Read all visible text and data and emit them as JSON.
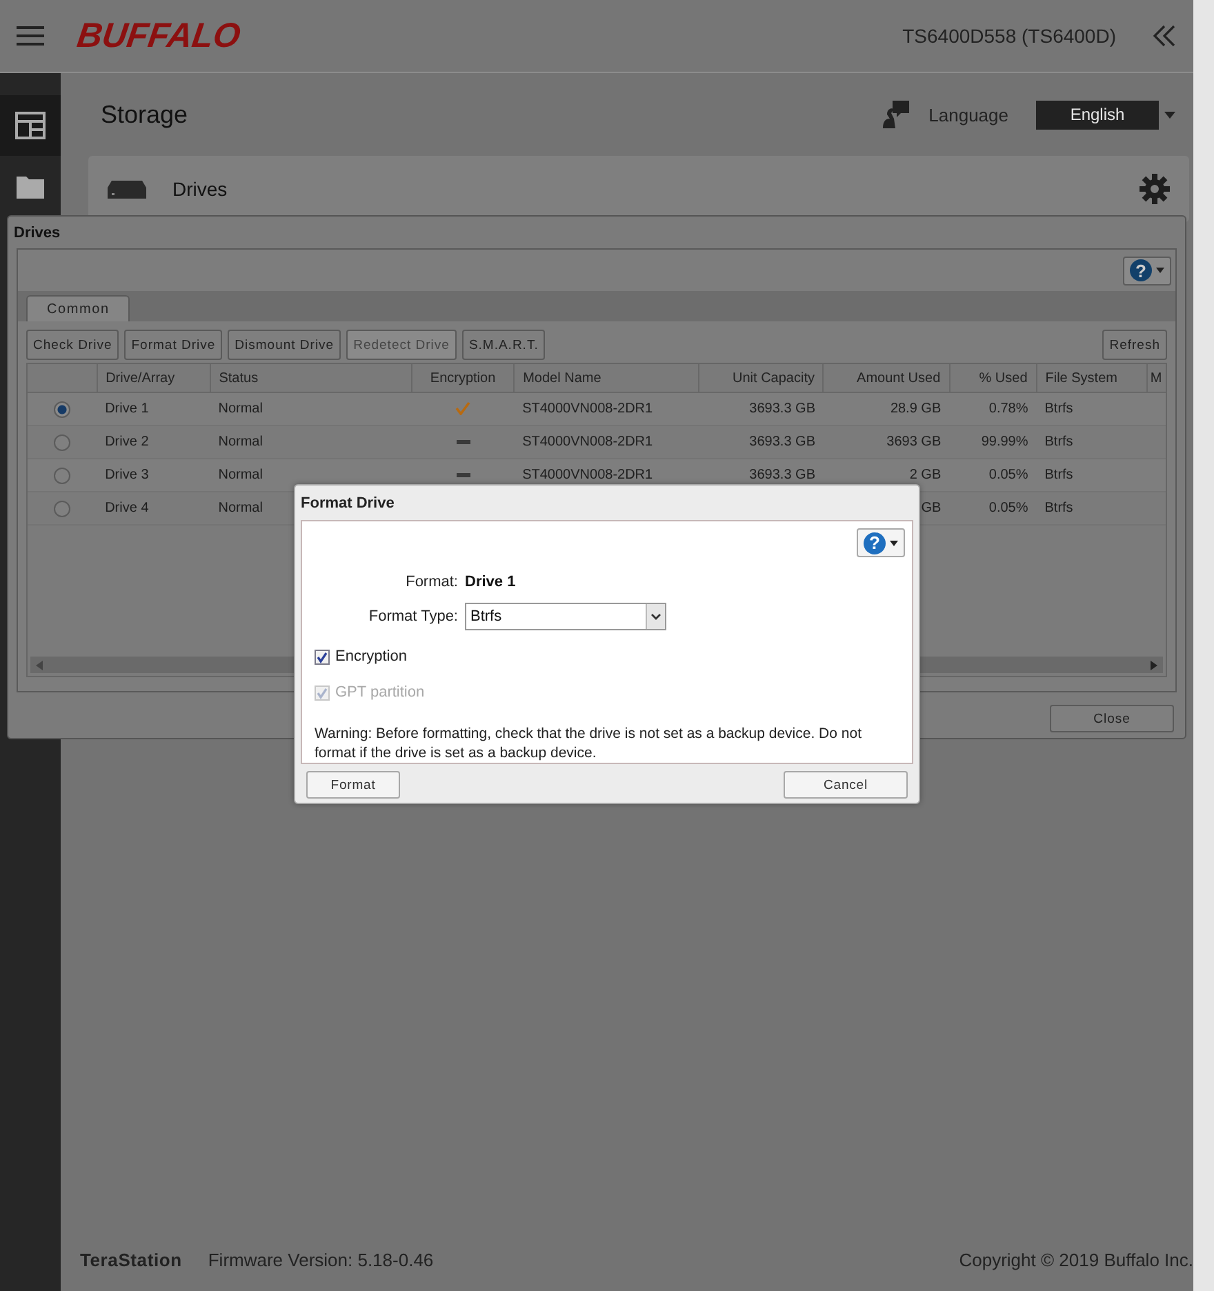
{
  "header": {
    "logo": "BUFFALO",
    "device": "TS6400D558 (TS6400D)"
  },
  "page": {
    "title": "Storage",
    "language_label": "Language",
    "language": "English",
    "card_title": "Drives"
  },
  "drives_window": {
    "title": "Drives",
    "help": "?",
    "tabs": [
      {
        "label": "Common",
        "selected": true
      }
    ],
    "buttons": [
      {
        "label": "Check Drive",
        "disabled": false
      },
      {
        "label": "Format Drive",
        "disabled": false
      },
      {
        "label": "Dismount Drive",
        "disabled": false
      },
      {
        "label": "Redetect Drive",
        "disabled": true
      },
      {
        "label": "S.M.A.R.T.",
        "disabled": false
      }
    ],
    "refresh": "Refresh",
    "columns": [
      "",
      "Drive/Array",
      "Status",
      "Encryption",
      "Model Name",
      "Unit Capacity",
      "Amount Used",
      "% Used",
      "File System",
      "M"
    ],
    "rows": [
      {
        "selected": true,
        "drive": "Drive 1",
        "status": "Normal",
        "encryption": {
          "kind": "check"
        },
        "model": "ST4000VN008-2DR1",
        "capacity": "3693.3 GB",
        "used": "28.9 GB",
        "percent": "0.78%",
        "file_system": "Btrfs"
      },
      {
        "selected": false,
        "drive": "Drive 2",
        "status": "Normal",
        "encryption": {
          "kind": "dash"
        },
        "model": "ST4000VN008-2DR1",
        "capacity": "3693.3 GB",
        "used": "3693 GB",
        "percent": "99.99%",
        "file_system": "Btrfs"
      },
      {
        "selected": false,
        "drive": "Drive 3",
        "status": "Normal",
        "encryption": {
          "kind": "dash"
        },
        "model": "ST4000VN008-2DR1",
        "capacity": "3693.3 GB",
        "used": "2 GB",
        "percent": "0.05%",
        "file_system": "Btrfs"
      },
      {
        "selected": false,
        "drive": "Drive 4",
        "status": "Normal",
        "used": "GB",
        "percent": "0.05%",
        "file_system": "Btrfs"
      }
    ],
    "close": "Close"
  },
  "format_dialog": {
    "title": "Format Drive",
    "help": "?",
    "format_label": "Format:",
    "format_value": "Drive 1",
    "type_label": "Format Type:",
    "type_value": "Btrfs",
    "options": [
      {
        "label": "Encryption",
        "checked": true,
        "disabled": false
      },
      {
        "label": "GPT partition",
        "checked": true,
        "disabled": true
      }
    ],
    "warning": "Warning: Before formatting, check that the drive is not set as a backup device. Do not format if the drive is set as a backup device.",
    "buttons": [
      "Format",
      "Cancel"
    ]
  },
  "footer": {
    "brand": "TeraStation",
    "firmware": "Firmware Version: 5.18-0.46",
    "copyright": "Copyright © 2019 Buffalo Inc."
  }
}
